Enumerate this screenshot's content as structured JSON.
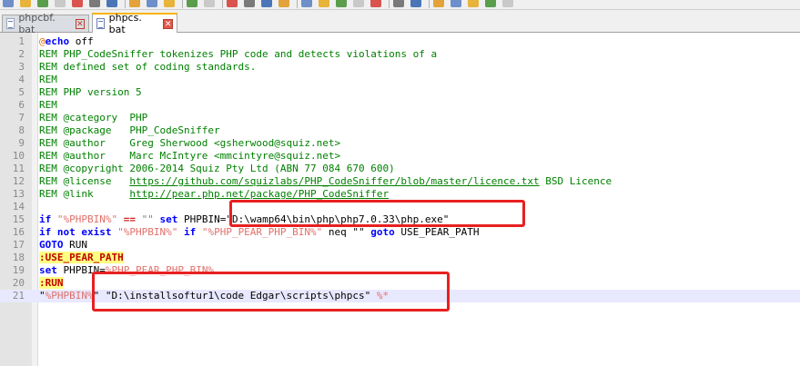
{
  "tabs": [
    {
      "label": "phpcbf. bat",
      "active": false
    },
    {
      "label": "phpcs. bat",
      "active": true
    }
  ],
  "toolbar_icons": [
    "new-icon",
    "open-icon",
    "save-icon",
    "save-all-icon",
    "close-icon",
    "close-all-icon",
    "print-icon",
    "cut-icon",
    "copy-icon",
    "paste-icon",
    "undo-icon",
    "redo-icon",
    "find-icon",
    "replace-icon",
    "zoom-in-icon",
    "zoom-out-icon",
    "sync-v-icon",
    "sync-h-icon",
    "wrap-icon",
    "indent-icon",
    "function-list-icon",
    "doc-map-icon",
    "folder-icon",
    "record-icon",
    "stop-icon",
    "play-icon",
    "play-multi-icon",
    "save-macro-icon"
  ],
  "lines": [
    {
      "n": "1",
      "tokens": [
        {
          "t": "@",
          "c": "at"
        },
        {
          "t": "echo",
          "c": "kw"
        },
        {
          "t": " off",
          "c": "plain"
        }
      ]
    },
    {
      "n": "2",
      "tokens": [
        {
          "t": "REM PHP_CodeSniffer tokenizes PHP code and detects violations of a",
          "c": "rem"
        }
      ]
    },
    {
      "n": "3",
      "tokens": [
        {
          "t": "REM defined set of coding standards.",
          "c": "rem"
        }
      ]
    },
    {
      "n": "4",
      "tokens": [
        {
          "t": "REM",
          "c": "rem"
        }
      ]
    },
    {
      "n": "5",
      "tokens": [
        {
          "t": "REM PHP version 5",
          "c": "rem"
        }
      ]
    },
    {
      "n": "6",
      "tokens": [
        {
          "t": "REM",
          "c": "rem"
        }
      ]
    },
    {
      "n": "7",
      "tokens": [
        {
          "t": "REM @category  PHP",
          "c": "rem"
        }
      ]
    },
    {
      "n": "8",
      "tokens": [
        {
          "t": "REM @package   PHP_CodeSniffer",
          "c": "rem"
        }
      ]
    },
    {
      "n": "9",
      "tokens": [
        {
          "t": "REM @author    Greg Sherwood <gsherwood@squiz.net>",
          "c": "rem"
        }
      ]
    },
    {
      "n": "10",
      "tokens": [
        {
          "t": "REM @author    Marc McIntyre <mmcintyre@squiz.net>",
          "c": "rem"
        }
      ]
    },
    {
      "n": "11",
      "tokens": [
        {
          "t": "REM @copyright 2006-2014 Squiz Pty Ltd (ABN 77 084 670 600)",
          "c": "rem"
        }
      ]
    },
    {
      "n": "12",
      "tokens": [
        {
          "t": "REM @license   ",
          "c": "rem"
        },
        {
          "t": "https://github.com/squizlabs/PHP_CodeSniffer/blob/master/licence.txt",
          "c": "url"
        },
        {
          "t": " BSD Licence",
          "c": "rem"
        }
      ]
    },
    {
      "n": "13",
      "tokens": [
        {
          "t": "REM @link      ",
          "c": "rem"
        },
        {
          "t": "http://pear.php.net/package/PHP_CodeSniffer",
          "c": "url"
        }
      ]
    },
    {
      "n": "14",
      "tokens": []
    },
    {
      "n": "15",
      "tokens": [
        {
          "t": "if ",
          "c": "kw"
        },
        {
          "t": "\"%PHPBIN%\"",
          "c": "var"
        },
        {
          "t": " == ",
          "c": "eq"
        },
        {
          "t": "\"\" ",
          "c": "str"
        },
        {
          "t": "set ",
          "c": "kw"
        },
        {
          "t": "PHPBIN=\"D:\\wamp64\\bin\\php\\php7.0.33\\php.exe\"",
          "c": "plain"
        }
      ]
    },
    {
      "n": "16",
      "tokens": [
        {
          "t": "if not exist ",
          "c": "kw"
        },
        {
          "t": "\"%PHPBIN%\" ",
          "c": "var"
        },
        {
          "t": "if ",
          "c": "kw"
        },
        {
          "t": "\"%PHP_PEAR_PHP_BIN%\"",
          "c": "var"
        },
        {
          "t": " neq \"\" ",
          "c": "plain"
        },
        {
          "t": "goto ",
          "c": "kw"
        },
        {
          "t": "USE_PEAR_PATH",
          "c": "plain"
        }
      ]
    },
    {
      "n": "17",
      "tokens": [
        {
          "t": "GOTO ",
          "c": "kw"
        },
        {
          "t": "RUN",
          "c": "plain"
        }
      ]
    },
    {
      "n": "18",
      "tokens": [
        {
          "t": ":USE_PEAR_PATH",
          "c": "lbl"
        }
      ]
    },
    {
      "n": "19",
      "tokens": [
        {
          "t": "set ",
          "c": "kw"
        },
        {
          "t": "PHPBIN=",
          "c": "plain"
        },
        {
          "t": "%PHP_PEAR_PHP_BIN%",
          "c": "var"
        }
      ]
    },
    {
      "n": "20",
      "tokens": [
        {
          "t": ":RUN",
          "c": "lbl"
        }
      ]
    },
    {
      "n": "21",
      "tokens": [
        {
          "t": "\"",
          "c": "plain"
        },
        {
          "t": "%PHPBIN%",
          "c": "var"
        },
        {
          "t": "\" \"D:\\installsoftur1\\code Edgar\\scripts\\phpcs\" ",
          "c": "plain"
        },
        {
          "t": "%*",
          "c": "var"
        }
      ]
    }
  ],
  "current_line": "21",
  "colors": {
    "annotation": "#e82020",
    "current_line_bg": "#e8e8ff",
    "active_tab_accent": "#fab400"
  }
}
